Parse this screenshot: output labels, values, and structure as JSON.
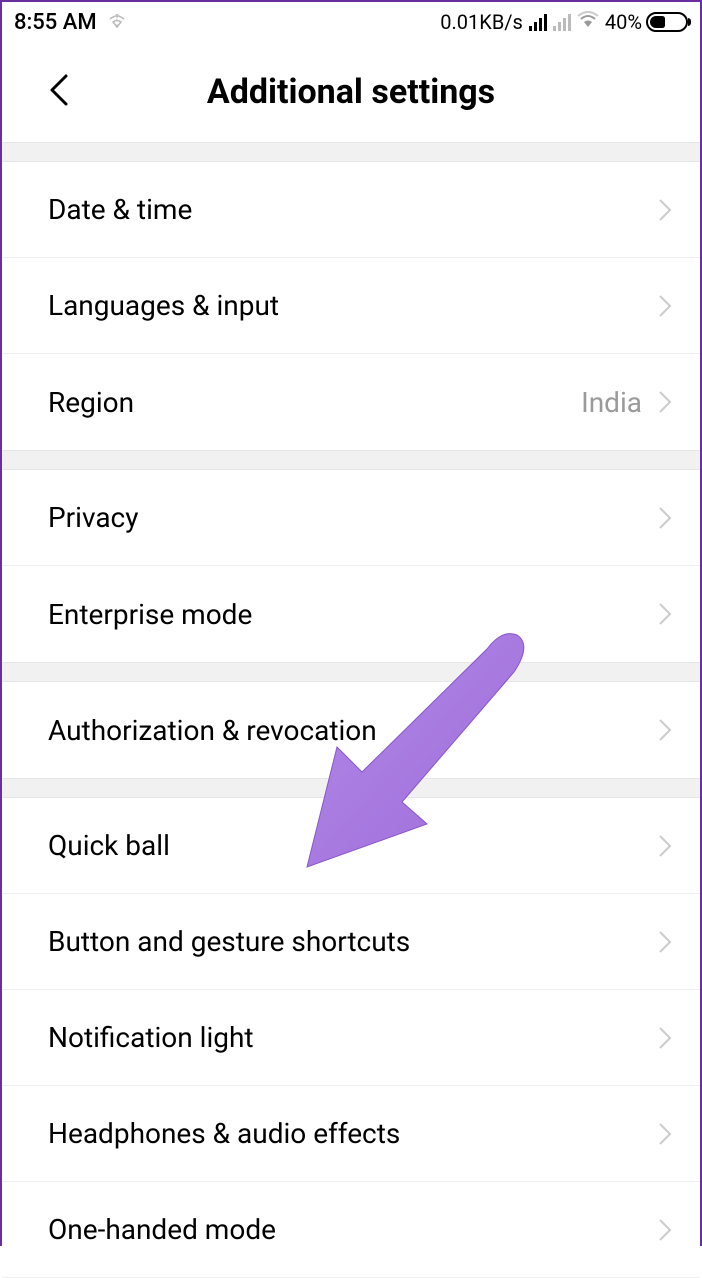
{
  "status_bar": {
    "time": "8:55 AM",
    "data_speed": "0.01KB/s",
    "battery_pct": "40%"
  },
  "header": {
    "title": "Additional settings"
  },
  "groups": [
    {
      "items": [
        {
          "label": "Date & time",
          "value": ""
        },
        {
          "label": "Languages & input",
          "value": ""
        },
        {
          "label": "Region",
          "value": "India"
        }
      ]
    },
    {
      "items": [
        {
          "label": "Privacy",
          "value": ""
        },
        {
          "label": "Enterprise mode",
          "value": ""
        }
      ]
    },
    {
      "items": [
        {
          "label": "Authorization & revocation",
          "value": ""
        }
      ]
    },
    {
      "items": [
        {
          "label": "Quick ball",
          "value": ""
        },
        {
          "label": "Button and gesture shortcuts",
          "value": ""
        },
        {
          "label": "Notification light",
          "value": ""
        },
        {
          "label": "Headphones & audio effects",
          "value": ""
        },
        {
          "label": "One-handed mode",
          "value": ""
        }
      ]
    }
  ]
}
